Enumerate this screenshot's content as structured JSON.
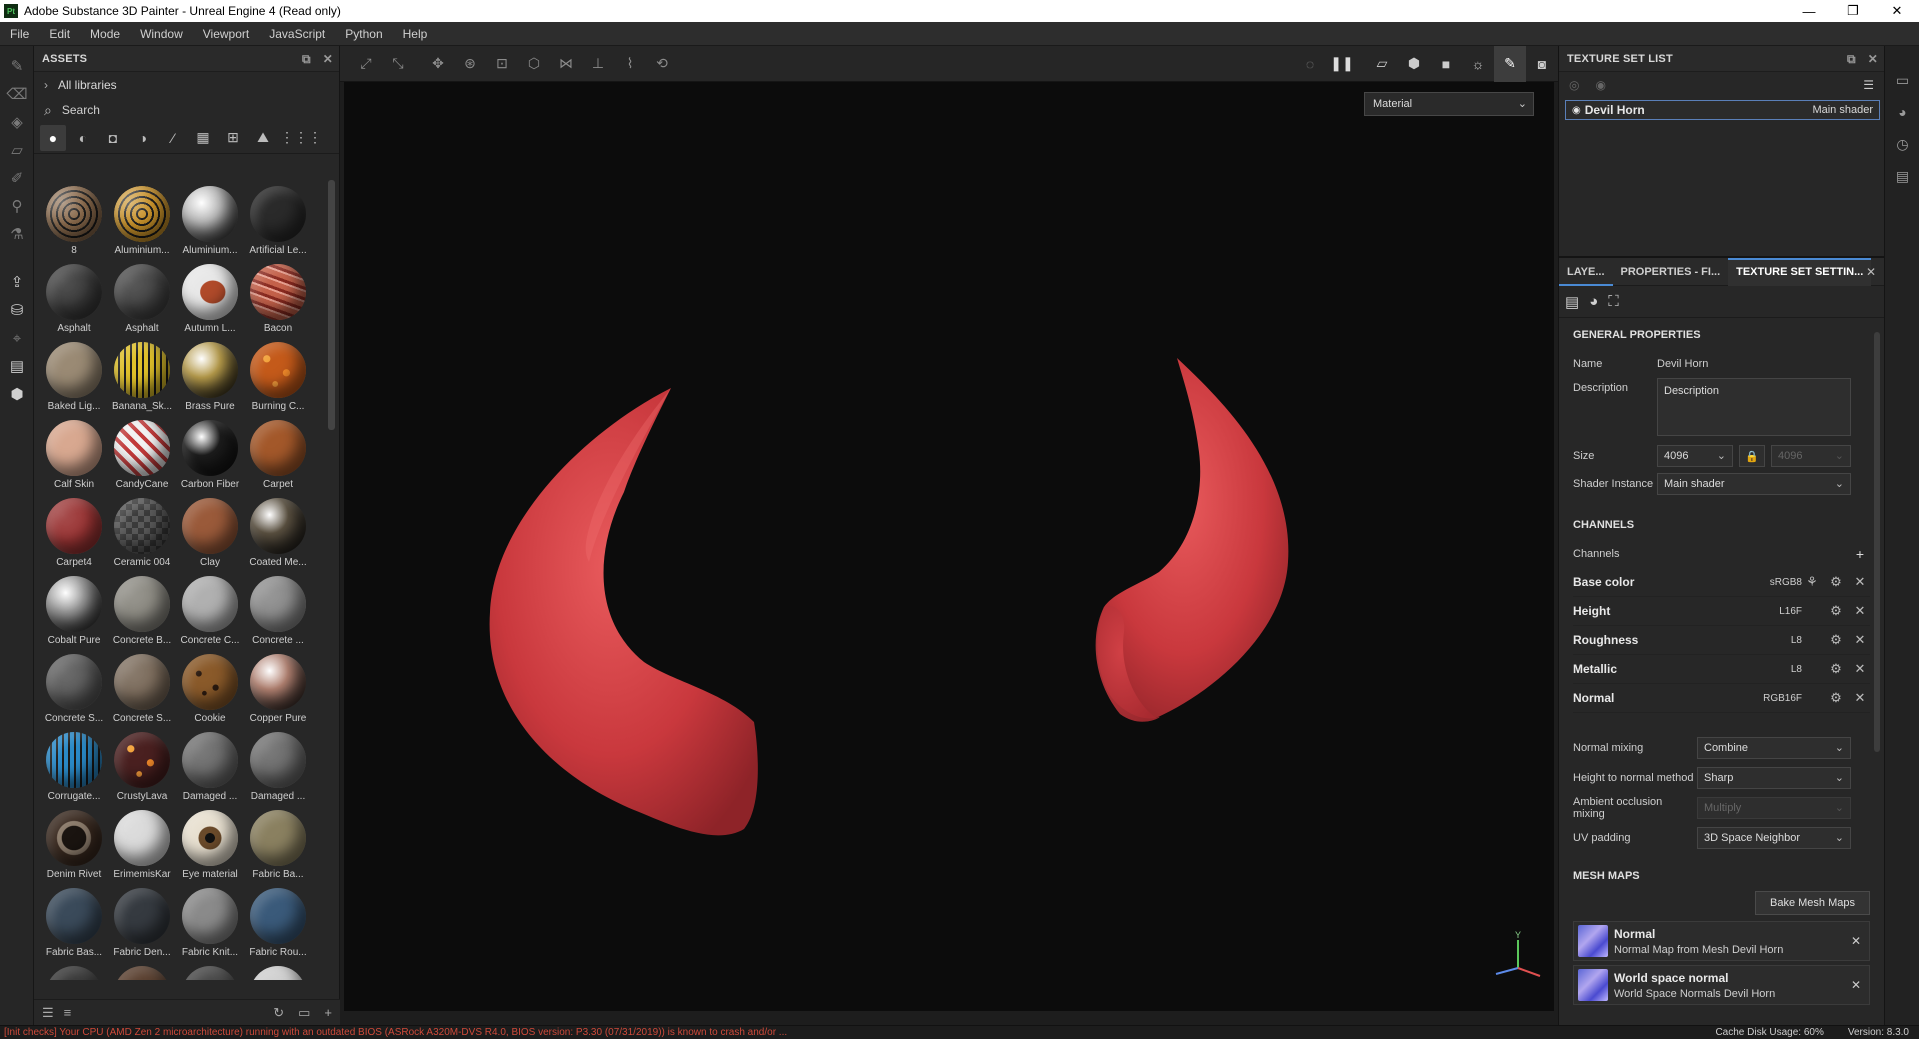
{
  "window": {
    "title": "Adobe Substance 3D Painter - Unreal Engine 4 (Read only)",
    "logo_text": "Pt",
    "minimize": "—",
    "maximize": "❐",
    "close": "✕"
  },
  "menu": [
    "File",
    "Edit",
    "Mode",
    "Window",
    "Viewport",
    "JavaScript",
    "Python",
    "Help"
  ],
  "assets": {
    "title": "ASSETS",
    "libraries": "All libraries",
    "search_placeholder": "Search",
    "items": [
      {
        "label": "8",
        "color": "#8a6a4c",
        "pattern": "quilt"
      },
      {
        "label": "Aluminium...",
        "color": "#c9922a",
        "pattern": "hex"
      },
      {
        "label": "Aluminium...",
        "color": "#b8b8b8",
        "pattern": "metal"
      },
      {
        "label": "Artificial Le...",
        "color": "#2a2a2a",
        "pattern": "plain"
      },
      {
        "label": "Asphalt",
        "color": "#3b3b3b",
        "pattern": "noise"
      },
      {
        "label": "Asphalt",
        "color": "#444444",
        "pattern": "noise"
      },
      {
        "label": "Autumn L...",
        "color": "#e8e8e8",
        "pattern": "leaf"
      },
      {
        "label": "Bacon",
        "color": "#a64a3a",
        "pattern": "bacon"
      },
      {
        "label": "Baked Lig...",
        "color": "#9a8a74",
        "pattern": "plain"
      },
      {
        "label": "Banana_Sk...",
        "color": "#e0c12a",
        "pattern": "stripes"
      },
      {
        "label": "Brass Pure",
        "color": "#b59a4a",
        "pattern": "metal"
      },
      {
        "label": "Burning C...",
        "color": "#c45a1a",
        "pattern": "lava"
      },
      {
        "label": "Calf Skin",
        "color": "#d8a890",
        "pattern": "plain"
      },
      {
        "label": "CandyCane",
        "color": "#e8d4d4",
        "pattern": "candy"
      },
      {
        "label": "Carbon Fiber",
        "color": "#1c1c1c",
        "pattern": "metal"
      },
      {
        "label": "Carpet",
        "color": "#a3582a",
        "pattern": "plain"
      },
      {
        "label": "Carpet4",
        "color": "#9a3434",
        "pattern": "noise"
      },
      {
        "label": "Ceramic 004",
        "color": "#4a4a4a",
        "pattern": "checker"
      },
      {
        "label": "Clay",
        "color": "#9a5a3a",
        "pattern": "plain"
      },
      {
        "label": "Coated Me...",
        "color": "#5a5040",
        "pattern": "metal"
      },
      {
        "label": "Cobalt Pure",
        "color": "#9a9a9a",
        "pattern": "metal"
      },
      {
        "label": "Concrete B...",
        "color": "#8a8880",
        "pattern": "noise"
      },
      {
        "label": "Concrete C...",
        "color": "#b0b0b0",
        "pattern": "plain"
      },
      {
        "label": "Concrete ...",
        "color": "#8a8a8a",
        "pattern": "noise"
      },
      {
        "label": "Concrete S...",
        "color": "#5a5a5a",
        "pattern": "noise"
      },
      {
        "label": "Concrete S...",
        "color": "#7a6a5a",
        "pattern": "noise"
      },
      {
        "label": "Cookie",
        "color": "#8a5a2a",
        "pattern": "cookie"
      },
      {
        "label": "Copper Pure",
        "color": "#b08070",
        "pattern": "metal"
      },
      {
        "label": "Corrugate...",
        "color": "#2a8ac8",
        "pattern": "stripes"
      },
      {
        "label": "CrustyLava",
        "color": "#4a2020",
        "pattern": "lava"
      },
      {
        "label": "Damaged ...",
        "color": "#6a6a6a",
        "pattern": "noise"
      },
      {
        "label": "Damaged ...",
        "color": "#6a6a6a",
        "pattern": "noise"
      },
      {
        "label": "Denim Rivet",
        "color": "#3a2a20",
        "pattern": "ring"
      },
      {
        "label": "ErimemisKar",
        "color": "#d8d8d8",
        "pattern": "noise"
      },
      {
        "label": "Eye material",
        "color": "#c8b890",
        "pattern": "eye"
      },
      {
        "label": "Fabric Ba...",
        "color": "#8a8060",
        "pattern": "plain"
      },
      {
        "label": "Fabric Bas...",
        "color": "#3a4a5a",
        "pattern": "plain"
      },
      {
        "label": "Fabric Den...",
        "color": "#353a40",
        "pattern": "plain"
      },
      {
        "label": "Fabric Knit...",
        "color": "#8a8a8a",
        "pattern": "plain"
      },
      {
        "label": "Fabric Rou...",
        "color": "#3a5a7a",
        "pattern": "plain"
      },
      {
        "label": "",
        "color": "#3a3a3a",
        "pattern": "plain"
      },
      {
        "label": "",
        "color": "#5a4030",
        "pattern": "plain"
      },
      {
        "label": "",
        "color": "#4a4a4a",
        "pattern": "plain"
      },
      {
        "label": "",
        "color": "#d0d0d0",
        "pattern": "plain"
      }
    ]
  },
  "viewport": {
    "mode_select": "Material",
    "horn_color": "#d9474a"
  },
  "texture_set_list": {
    "title": "TEXTURE SET LIST",
    "item_name": "Devil Horn",
    "item_shader": "Main shader"
  },
  "tabs": {
    "layers": "LAYE...",
    "properties": "PROPERTIES - FI...",
    "texture_set_settings": "TEXTURE SET SETTIN..."
  },
  "general": {
    "heading": "GENERAL PROPERTIES",
    "name_label": "Name",
    "name_value": "Devil Horn",
    "description_label": "Description",
    "description_value": "Description",
    "size_label": "Size",
    "size_value": "4096",
    "size_value2": "4096",
    "shader_label": "Shader Instance",
    "shader_value": "Main shader"
  },
  "channels": {
    "heading": "CHANNELS",
    "label": "Channels",
    "items": [
      {
        "name": "Base color",
        "format": "sRGB8"
      },
      {
        "name": "Height",
        "format": "L16F"
      },
      {
        "name": "Roughness",
        "format": "L8"
      },
      {
        "name": "Metallic",
        "format": "L8"
      },
      {
        "name": "Normal",
        "format": "RGB16F"
      }
    ]
  },
  "mixing": {
    "normal_mixing_label": "Normal mixing",
    "normal_mixing_value": "Combine",
    "height_to_normal_label": "Height to normal method",
    "height_to_normal_value": "Sharp",
    "ao_mixing_label": "Ambient occlusion mixing",
    "ao_mixing_value": "Multiply",
    "uv_padding_label": "UV padding",
    "uv_padding_value": "3D Space Neighbor"
  },
  "mesh_maps": {
    "heading": "MESH MAPS",
    "bake_button": "Bake Mesh Maps",
    "items": [
      {
        "title": "Normal",
        "subtitle": "Normal Map from Mesh Devil Horn"
      },
      {
        "title": "World space normal",
        "subtitle": "World Space Normals Devil Horn"
      }
    ]
  },
  "status": {
    "warning": "[Init checks] Your CPU (AMD Zen 2 microarchitecture) running with an outdated BIOS (ASRock A320M-DVS R4.0, BIOS version: P3.30 (07/31/2019)) is known to crash and/or ...",
    "cache": "Cache Disk Usage:",
    "cache_value": "60%",
    "version": "Version: 8.3.0"
  }
}
